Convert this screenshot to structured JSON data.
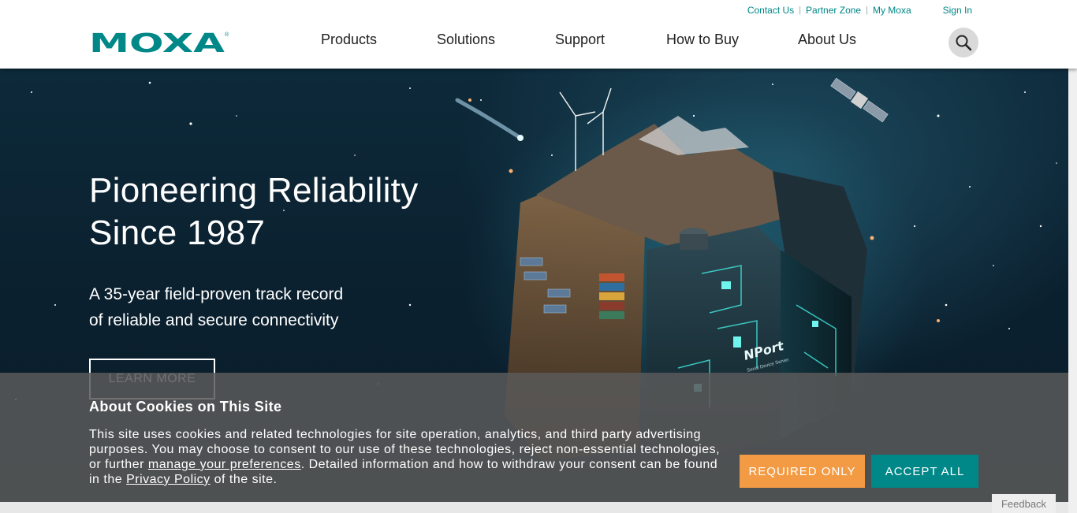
{
  "header": {
    "logo_text": "MOXA",
    "util_links": [
      "Contact Us",
      "Partner Zone",
      "My Moxa"
    ],
    "sign_in": "Sign In",
    "nav": [
      "Products",
      "Solutions",
      "Support",
      "How to Buy",
      "About Us"
    ],
    "search_icon": "search-icon"
  },
  "hero": {
    "title_line1": "Pioneering Reliability",
    "title_line2": "Since 1987",
    "subtitle_line1": "A 35-year field-proven track record",
    "subtitle_line2": "of reliable and secure connectivity",
    "cta": "LEARN MORE",
    "device_brand": "NPort",
    "device_model": "Serial Device Server"
  },
  "cookie": {
    "title": "About Cookies on This Site",
    "text_part1": "This site uses cookies and related technologies for site operation, analytics, and third party advertising purposes. You may choose to consent to our use of these technologies, reject non-essential technologies, or further ",
    "link_preferences": "manage your preferences",
    "text_part2": ". Detailed information and how to withdraw your consent can be found in the ",
    "link_privacy": "Privacy Policy",
    "text_part3": " of the site.",
    "required_only": "REQUIRED ONLY",
    "accept_all": "ACCEPT ALL"
  },
  "feedback": "Feedback",
  "colors": {
    "brand_teal": "#008787",
    "accept_button": "#008787",
    "required_button": "#f39b44",
    "banner_overlay": "#5a5a5a",
    "hero_background": "#0b2130"
  }
}
